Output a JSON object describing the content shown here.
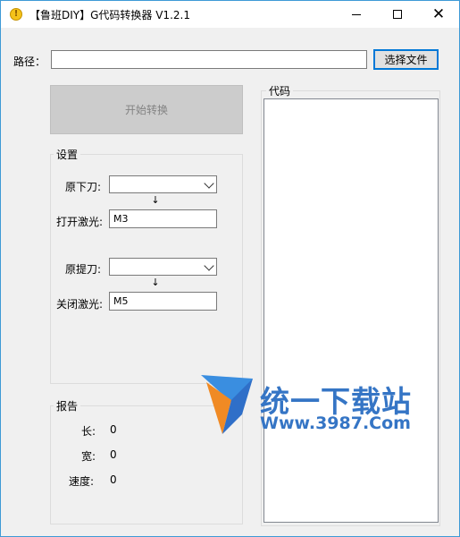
{
  "window": {
    "title": "【鲁班DIY】G代码转换器 V1.2.1"
  },
  "path": {
    "label": "路径：",
    "value": "",
    "browse_label": "选择文件"
  },
  "convert_button": {
    "label": "开始转换"
  },
  "settings": {
    "title": "设置",
    "pen_down_label": "原下刀:",
    "pen_down_value": "",
    "laser_on_label": "打开激光:",
    "laser_on_value": "M3",
    "pen_up_label": "原提刀:",
    "pen_up_value": "",
    "laser_off_label": "关闭激光:",
    "laser_off_value": "M5"
  },
  "report": {
    "title": "报告",
    "length_label": "长:",
    "length_value": "0",
    "width_label": "宽:",
    "width_value": "0",
    "speed_label": "速度:",
    "speed_value": "0"
  },
  "code": {
    "title": "代码",
    "content": ""
  },
  "watermark": {
    "title": "统一下载站",
    "url": "Www.3987.Com"
  },
  "icons": {
    "app": "warning-icon",
    "minimize": "minimize-icon",
    "maximize": "maximize-icon",
    "close": "close-icon"
  }
}
